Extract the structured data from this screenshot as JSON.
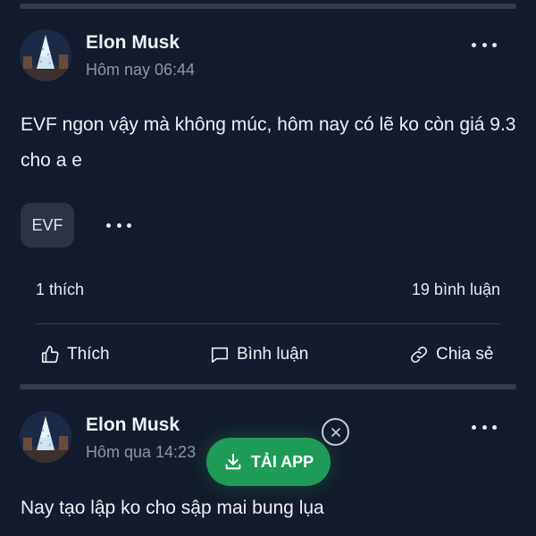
{
  "posts": [
    {
      "author": "Elon Musk",
      "time": "Hôm nay 06:44",
      "content": "EVF ngon vậy mà không múc, hôm nay có lẽ ko còn giá 9.3 cho a e",
      "tag": "EVF",
      "likes": "1 thích",
      "comments": "19 bình luận",
      "actions": {
        "like": "Thích",
        "comment": "Bình luận",
        "share": "Chia sẻ"
      }
    },
    {
      "author": "Elon Musk",
      "time": "Hôm qua 14:23",
      "content": "Nay tạo lập ko cho sập mai bung lụa"
    }
  ],
  "app_banner": {
    "label": "TẢI APP",
    "accent": "#1e9c57"
  },
  "icons": [
    "more-icon",
    "like-icon",
    "comment-icon",
    "share-icon",
    "close-icon",
    "download-icon"
  ],
  "colors": {
    "background": "#131b2c",
    "divider": "#333c4d",
    "muted_text": "#8f97a6"
  }
}
